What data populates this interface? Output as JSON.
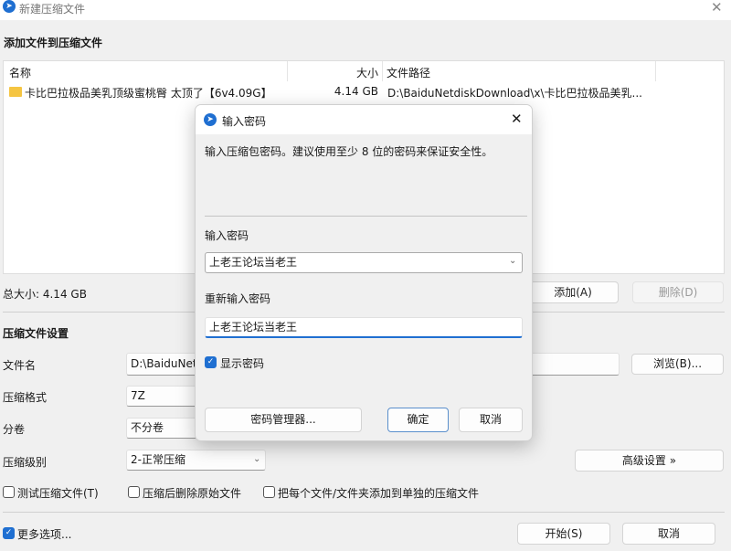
{
  "window": {
    "title": "新建压缩文件",
    "close": "✕"
  },
  "section_add": "添加文件到压缩文件",
  "list": {
    "headers": [
      "名称",
      "大小",
      "文件路径"
    ],
    "rows": [
      {
        "name": "卡比巴拉极品美乳顶级蜜桃臀 太顶了【6v4.09G】",
        "size": "4.14 GB",
        "path": "D:\\BaiduNetdiskDownload\\x\\卡比巴拉极品美乳..."
      }
    ]
  },
  "total": "总大小: 4.14 GB",
  "add_btn": "添加(A)",
  "delete_btn": "删除(D)",
  "section_settings": "压缩文件设置",
  "filename": {
    "label": "文件名",
    "value": "D:\\BaiduNet"
  },
  "browse_btn": "浏览(B)...",
  "format": {
    "label": "压缩格式",
    "value": "7Z"
  },
  "split": {
    "label": "分卷",
    "value": "不分卷"
  },
  "level": {
    "label": "压缩级别",
    "value": "2-正常压缩"
  },
  "advanced_btn": "高级设置 »",
  "options": [
    "测试压缩文件(T)",
    "压缩后删除原始文件",
    "把每个文件/文件夹添加到单独的压缩文件"
  ],
  "more": "更多选项...",
  "start_btn": "开始(S)",
  "cancel_btn": "取消",
  "dialog": {
    "title": "输入密码",
    "desc": "输入压缩包密码。建议使用至少 8 位的密码来保证安全性。",
    "pw_label": "输入密码",
    "pw_value": "上老王论坛当老王",
    "re_label": "重新输入密码",
    "re_value": "上老王论坛当老王",
    "show": "显示密码",
    "manager_btn": "密码管理器...",
    "ok_btn": "确定",
    "cancel_btn": "取消",
    "close": "✕"
  },
  "colors": {
    "accent": "#1f6fd1"
  }
}
